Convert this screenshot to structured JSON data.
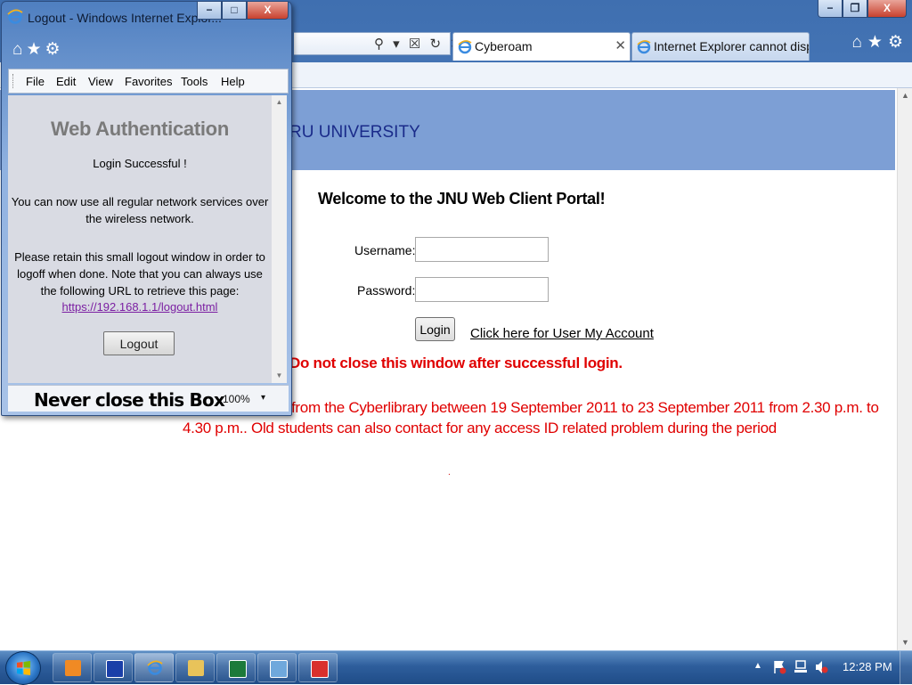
{
  "main_window": {
    "address_tools": "⚲ ▾ ☒ ↻ ✕",
    "tabs": [
      {
        "label": "Cyberoam",
        "close": "✕"
      },
      {
        "label": "Internet Explorer cannot displa..."
      }
    ],
    "nav_icons": "⌂★⚙",
    "controls": {
      "minimize": "−",
      "maximize": "❐",
      "close": "X"
    }
  },
  "page": {
    "banner_text": "RU UNIVERSITY",
    "welcome": "Welcome to the JNU Web Client Portal!",
    "username_label": "Username:",
    "password_label": "Password:",
    "username_value": "",
    "password_value": "",
    "login_button": "Login",
    "my_account_link": "Click here for User My Account",
    "warning": "Do not close this window after successful login.",
    "notice": "from the Cyberlibrary between 19 September 2011 to 23 September 2011 from 2.30 p.m. to 4.30 p.m.. Old students can also contact for any access ID related problem during the period",
    "dot": "."
  },
  "popup": {
    "title": "Logout - Windows Internet Explor...",
    "controls": {
      "minimize": "−",
      "maximize": "□",
      "close": "X"
    },
    "nav_icons": "⌂★⚙",
    "menu": [
      "File",
      "Edit",
      "View",
      "Favorites",
      "Tools",
      "Help"
    ],
    "auth_title": "Web Authentication",
    "login_success": "Login Successful !",
    "services_text": "You can now use all regular network services over the wireless network.",
    "retain_text": "Please retain this small logout window in order to logoff when done. Note that you can always use the following URL to retrieve this page:",
    "logout_url": "https://192.168.1.1/logout.html",
    "logout_button": "Logout",
    "status_note": "Never close this Box",
    "zoom": "100%",
    "zoom_caret": "▾"
  },
  "taskbar": {
    "apps": [
      "media-player-icon",
      "presentation-icon",
      "internet-explorer-icon",
      "file-explorer-icon",
      "excel-icon",
      "remote-desktop-icon",
      "acrobat-icon"
    ],
    "tray_arrow": "▲",
    "clock": "12:28 PM"
  },
  "colors": {
    "banner": "#7d9fd5",
    "warning_red": "#e00000",
    "link_purple": "#7b1fa2",
    "title_gray": "#7a7a7a"
  }
}
